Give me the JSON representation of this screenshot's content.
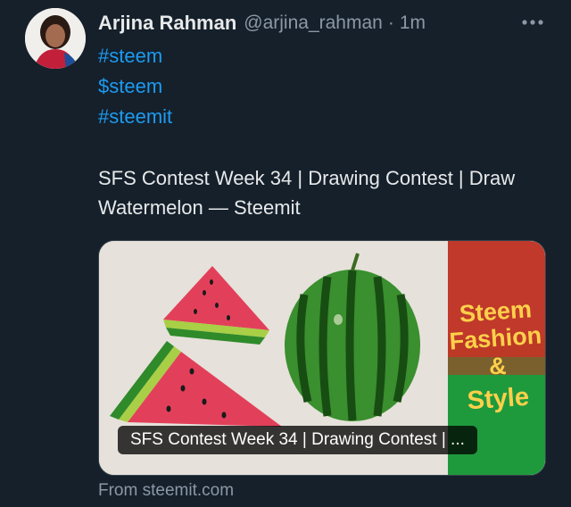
{
  "tweet": {
    "author_name": "Arjina Rahman",
    "author_handle": "@arjina_rahman",
    "separator": "·",
    "time": "1m",
    "more_icon": "more-horizontal-icon",
    "hashtags": [
      "#steem",
      "$steem",
      "#steemit"
    ],
    "text": "SFS Contest Week 34 | Drawing Contest | Draw Watermelon — Steemit"
  },
  "card": {
    "title": "SFS Contest Week 34 | Drawing Contest | ...",
    "image_text": [
      "Steem",
      "Fashion",
      "&",
      "Style"
    ],
    "source": "From steemit.com"
  },
  "colors": {
    "background": "#15202b",
    "link": "#1d9bf0",
    "muted": "#8b98a5",
    "text": "#e7e9ea"
  }
}
